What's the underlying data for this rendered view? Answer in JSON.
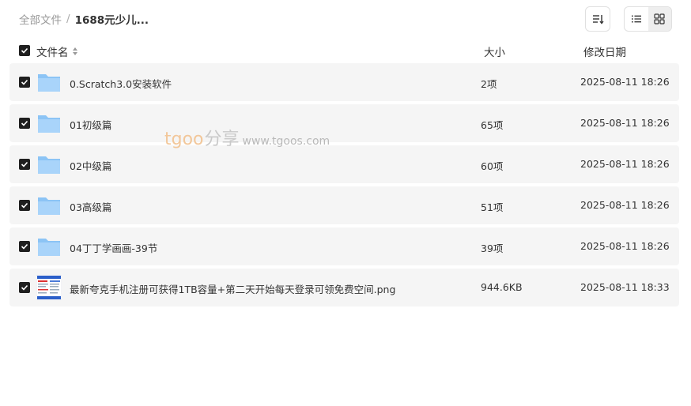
{
  "breadcrumb": {
    "root": "全部文件",
    "separator": "/",
    "current": "1688元少儿..."
  },
  "toolbar": {
    "sort_icon": "sort-icon",
    "list_icon": "list-view-icon",
    "grid_icon": "grid-view-icon"
  },
  "table": {
    "headers": {
      "name": "文件名",
      "size": "大小",
      "date": "修改日期"
    },
    "rows": [
      {
        "name": "0.Scratch3.0安装软件",
        "size": "2项",
        "date": "2025-08-11 18:26",
        "type": "folder"
      },
      {
        "name": "01初级篇",
        "size": "65项",
        "date": "2025-08-11 18:26",
        "type": "folder"
      },
      {
        "name": "02中级篇",
        "size": "60项",
        "date": "2025-08-11 18:26",
        "type": "folder"
      },
      {
        "name": "03高级篇",
        "size": "51项",
        "date": "2025-08-11 18:26",
        "type": "folder"
      },
      {
        "name": "04丁丁学画画-39节",
        "size": "39项",
        "date": "2025-08-11 18:26",
        "type": "folder"
      },
      {
        "name": "最新夸克手机注册可获得1TB容量+第二天开始每天登录可领免费空间.png",
        "size": "944.6KB",
        "date": "2025-08-11 18:33",
        "type": "image"
      }
    ]
  },
  "watermark": {
    "brand": "tgoo",
    "cn": "分享",
    "url": "www.tgoos.com"
  },
  "colors": {
    "row_bg": "#f5f5f5",
    "folder_blue": "#8cc4f5",
    "checkbox": "#1f1f1f"
  }
}
